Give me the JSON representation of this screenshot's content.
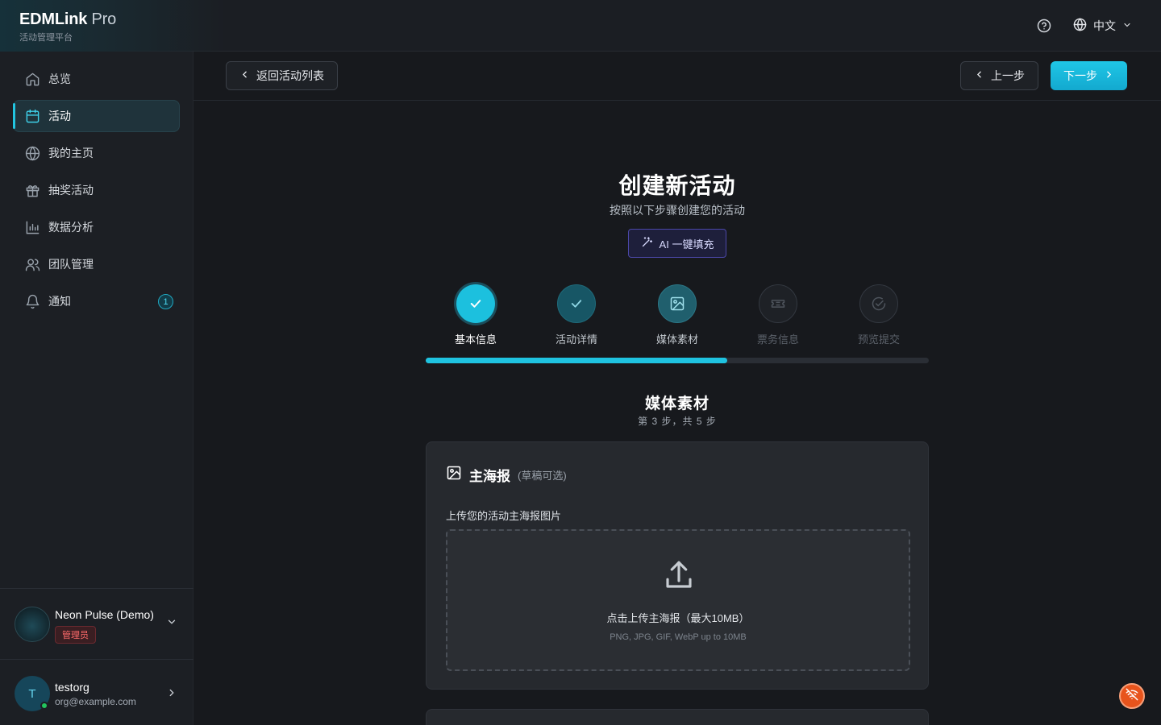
{
  "brand": {
    "name": "EDMLink",
    "suffix": "Pro",
    "subtitle": "活动管理平台"
  },
  "header": {
    "language": "中文"
  },
  "sidebar": {
    "items": [
      {
        "label": "总览",
        "icon": "home-icon"
      },
      {
        "label": "活动",
        "icon": "calendar-icon",
        "active": true
      },
      {
        "label": "我的主页",
        "icon": "globe-icon"
      },
      {
        "label": "抽奖活动",
        "icon": "gift-icon"
      },
      {
        "label": "数据分析",
        "icon": "bar-chart-icon"
      },
      {
        "label": "团队管理",
        "icon": "users-icon"
      },
      {
        "label": "通知",
        "icon": "bell-icon",
        "badge": "1"
      }
    ],
    "org": {
      "name": "Neon Pulse (Demo)",
      "role": "管理员"
    },
    "user": {
      "initial": "T",
      "name": "testorg",
      "email": "org@example.com"
    }
  },
  "actions": {
    "back": "返回活动列表",
    "prev": "上一步",
    "next": "下一步"
  },
  "page": {
    "title": "创建新活动",
    "subtitle": "按照以下步骤创建您的活动",
    "ai_fill": "AI 一键填充"
  },
  "steps": [
    {
      "label": "基本信息",
      "state": "done-active"
    },
    {
      "label": "活动详情",
      "state": "done"
    },
    {
      "label": "媒体素材",
      "state": "current"
    },
    {
      "label": "票务信息",
      "state": "todo"
    },
    {
      "label": "预览提交",
      "state": "todo"
    }
  ],
  "progress": {
    "percent": 60
  },
  "section": {
    "title": "媒体素材",
    "subtitle": "第 3 步，共 5 步"
  },
  "poster": {
    "title": "主海报",
    "note": "(草稿可选)",
    "label": "上传您的活动主海报图片",
    "upload_text": "点击上传主海报（最大10MB）",
    "upload_hint": "PNG, JPG, GIF, WebP up to 10MB"
  },
  "colors": {
    "accent": "#1fc3e0",
    "ai": "#4b47a8",
    "danger": "#ff6b6b",
    "float": "#e8541c"
  }
}
